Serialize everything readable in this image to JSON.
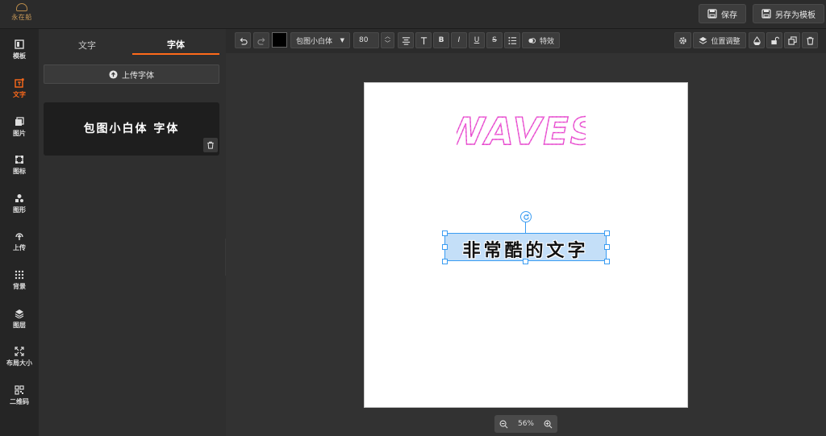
{
  "app": {
    "logo_text": "永在船",
    "save_label": "保存",
    "save_template_label": "另存为模板"
  },
  "rail": [
    {
      "label": "模板",
      "icon": "template-icon"
    },
    {
      "label": "文字",
      "icon": "text-icon",
      "active": true
    },
    {
      "label": "图片",
      "icon": "image-icon"
    },
    {
      "label": "图标",
      "icon": "icon-icon"
    },
    {
      "label": "图形",
      "icon": "shape-icon"
    },
    {
      "label": "上传",
      "icon": "upload-icon"
    },
    {
      "label": "背景",
      "icon": "background-icon"
    },
    {
      "label": "图层",
      "icon": "layers-icon"
    },
    {
      "label": "布局大小",
      "icon": "resize-icon"
    },
    {
      "label": "二维码",
      "icon": "qrcode-icon"
    }
  ],
  "panel": {
    "tabs": [
      {
        "label": "文字"
      },
      {
        "label": "字体",
        "active": true
      }
    ],
    "upload_label": "上传字体",
    "font_preview": "包图小白体 字体"
  },
  "toolbar": {
    "font_name": "包图小白体",
    "font_size": "80",
    "effects_label": "特效",
    "position_label": "位置调整",
    "text_color": "#000000"
  },
  "canvas": {
    "headline": "WAVES",
    "headline_color": "#e040c8",
    "selected_text": "非常酷的文字",
    "selection_color": "#3a9cf2"
  },
  "zoom": {
    "level": "56%"
  },
  "colors": {
    "accent": "#ff6a1a"
  }
}
